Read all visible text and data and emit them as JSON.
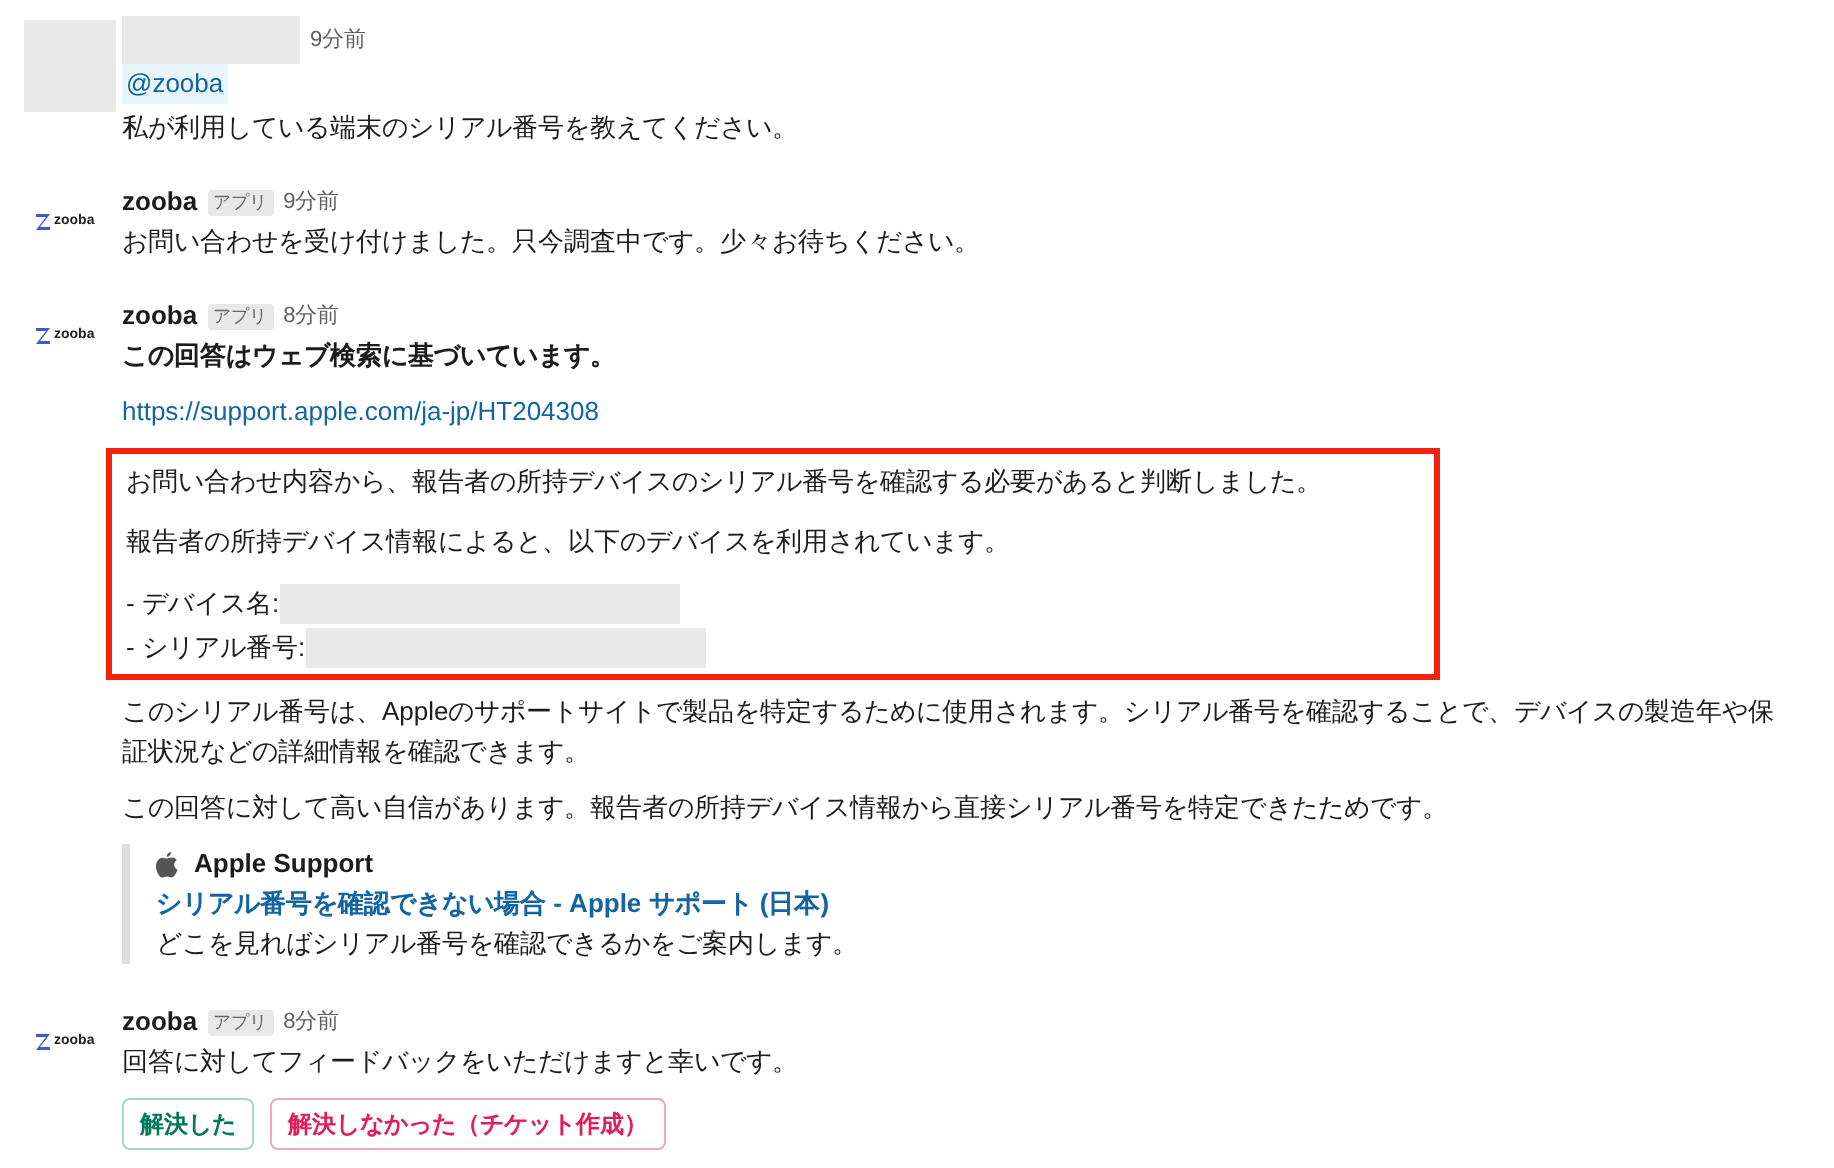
{
  "messages": [
    {
      "kind": "user",
      "avatar_redacted": true,
      "name_redacted": true,
      "time": "9分前",
      "mention": "@zooba",
      "blocks": [
        {
          "kind": "text",
          "text": "私が利用している端末のシリアル番号を教えてください。"
        }
      ]
    },
    {
      "kind": "app",
      "logo": "zooba",
      "name": "zooba",
      "badge": "アプリ",
      "time": "9分前",
      "blocks": [
        {
          "kind": "text",
          "text": "お問い合わせを受け付けました。只今調査中です。少々お待ちください。"
        }
      ]
    },
    {
      "kind": "app",
      "logo": "zooba",
      "name": "zooba",
      "badge": "アプリ",
      "time": "8分前",
      "blocks": [
        {
          "kind": "bold",
          "text": "この回答はウェブ検索に基づいています。"
        },
        {
          "kind": "link",
          "text": "https://support.apple.com/ja-jp/HT204308"
        },
        {
          "kind": "highlight",
          "lines": [
            {
              "text": "お問い合わせ内容から、報告者の所持デバイスのシリアル番号を確認する必要があると判断しました。",
              "value_redacted": false
            },
            {
              "text": "報告者の所持デバイス情報によると、以下のデバイスを利用されています。",
              "value_redacted": false
            },
            {
              "text": "- デバイス名:",
              "value_redacted": true
            },
            {
              "text": "- シリアル番号:",
              "value_redacted": true
            }
          ]
        },
        {
          "kind": "text",
          "text": "このシリアル番号は、Appleのサポートサイトで製品を特定するために使用されます。シリアル番号を確認することで、デバイスの製造年や保証状況などの詳細情報を確認できます。"
        },
        {
          "kind": "text",
          "text": "この回答に対して高い自信があります。報告者の所持デバイス情報から直接シリアル番号を特定できたためです。"
        },
        {
          "kind": "unfurl",
          "site": "Apple Support",
          "title": "シリアル番号を確認できない場合 - Apple サポート (日本)",
          "description": "どこを見ればシリアル番号を確認できるかをご案内します。"
        }
      ]
    },
    {
      "kind": "app",
      "logo": "zooba",
      "name": "zooba",
      "badge": "アプリ",
      "time": "8分前",
      "blocks": [
        {
          "kind": "text",
          "text": "回答に対してフィードバックをいただけますと幸いです。"
        },
        {
          "kind": "buttons",
          "buttons": [
            {
              "label": "解決した",
              "kind": "positive"
            },
            {
              "label": "解決しなかった（チケット作成）",
              "kind": "negative"
            }
          ]
        }
      ]
    }
  ]
}
